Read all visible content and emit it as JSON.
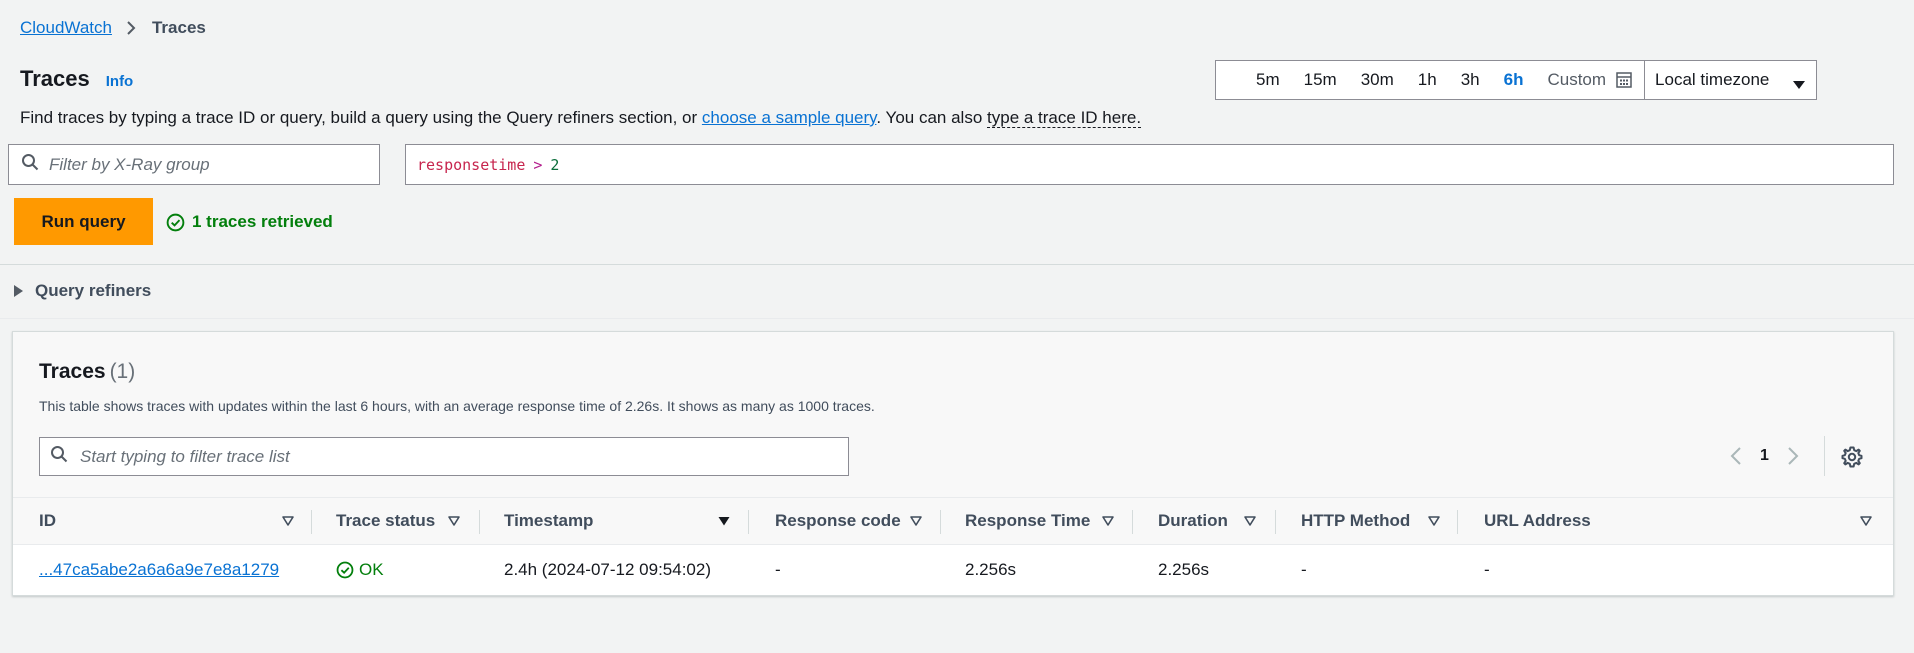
{
  "breadcrumb": {
    "parent": "CloudWatch",
    "current": "Traces"
  },
  "header": {
    "title": "Traces",
    "info": "Info",
    "description_pre": "Find traces by typing a trace ID or query, build a query using the Query refiners section, or ",
    "sample_query_link": "choose a sample query",
    "description_mid": ". You can also ",
    "trace_id_link": "type a trace ID here."
  },
  "time_range": {
    "options": [
      "5m",
      "15m",
      "30m",
      "1h",
      "3h",
      "6h"
    ],
    "selected": "6h",
    "custom": "Custom",
    "timezone": "Local timezone"
  },
  "group_filter": {
    "placeholder": "Filter by X-Ray group"
  },
  "query": {
    "field": "responsetime",
    "operator": ">",
    "value": "2"
  },
  "run_query": {
    "label": "Run query",
    "status": "1 traces retrieved"
  },
  "refiners": {
    "label": "Query refiners"
  },
  "traces_panel": {
    "title": "Traces",
    "count": "(1)",
    "description": "This table shows traces with updates within the last 6 hours, with an average response time of 2.26s. It shows as many as 1000 traces.",
    "filter_placeholder": "Start typing to filter trace list",
    "page": "1",
    "columns": [
      "ID",
      "Trace status",
      "Timestamp",
      "Response code",
      "Response Time",
      "Duration",
      "HTTP Method",
      "URL Address"
    ],
    "rows": [
      {
        "id": "...47ca5abe2a6a6a9e7e8a1279",
        "status": "OK",
        "timestamp": "2.4h (2024-07-12 09:54:02)",
        "response_code": "-",
        "response_time": "2.256s",
        "duration": "2.256s",
        "http_method": "-",
        "url": "-"
      }
    ]
  },
  "colors": {
    "link": "#0972d3",
    "primary_button": "#ff9900",
    "success": "#037f0c",
    "background": "#f2f3f3"
  }
}
